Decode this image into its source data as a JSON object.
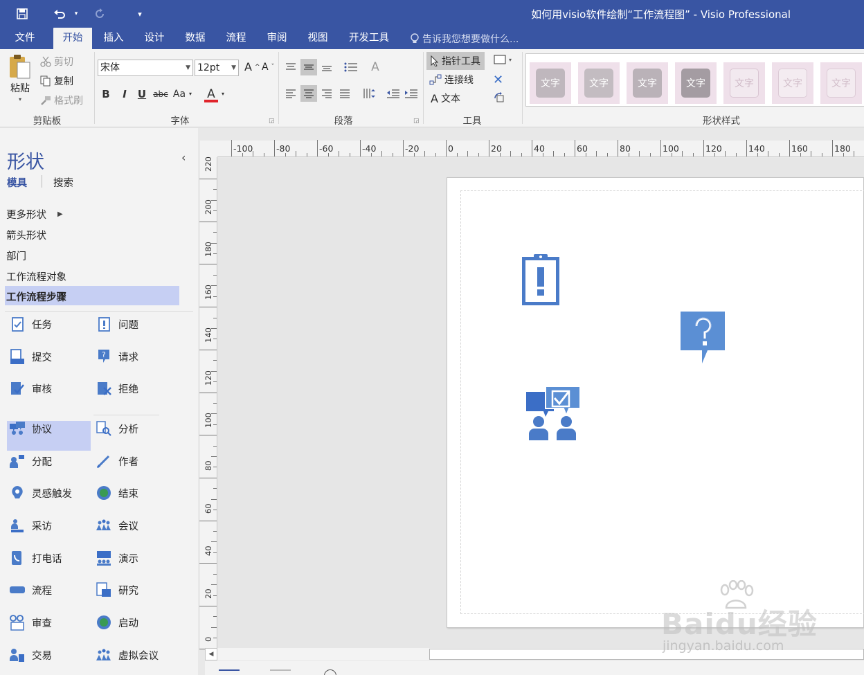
{
  "window": {
    "title": "如何用visio软件绘制“工作流程图” - Visio Professional"
  },
  "quick_access": {
    "save": "save-icon",
    "undo": "undo-icon",
    "redo": "redo-icon",
    "customize": "▾"
  },
  "menu": {
    "tabs": [
      "文件",
      "开始",
      "插入",
      "设计",
      "数据",
      "流程",
      "审阅",
      "视图",
      "开发工具"
    ],
    "active": "开始",
    "tell_me": "告诉我您想要做什么..."
  },
  "ribbon": {
    "clipboard": {
      "paste": "粘贴",
      "cut": "剪切",
      "copy": "复制",
      "format_painter": "格式刷",
      "label": "剪贴板"
    },
    "font": {
      "family": "宋体",
      "size": "12pt",
      "bold": "B",
      "italic": "I",
      "underline": "U",
      "strike": "abc",
      "case": "Aa",
      "grow": "A",
      "shrink": "A",
      "color_letter": "A",
      "label": "字体",
      "color": "#e0242b"
    },
    "paragraph": {
      "label": "段落"
    },
    "tools": {
      "pointer": "指针工具",
      "connector": "连接线",
      "text": "文本",
      "text_glyph": "A",
      "label": "工具"
    },
    "shape_styles": {
      "label": "形状样式",
      "swatch_text": "文字",
      "swatch_colors": [
        "#bfb7bd",
        "#c3bcc1",
        "#bab2b8",
        "#a49ca2",
        "#f2e9ef",
        "#f4ecf1",
        "#f3ebf0"
      ]
    }
  },
  "shapes_panel": {
    "title": "形状",
    "tabs": [
      "模具",
      "搜索"
    ],
    "stencils": [
      "更多形状",
      "箭头形状",
      "部门",
      "工作流程对象",
      "工作流程步骤"
    ],
    "selected_stencil": "工作流程步骤",
    "items": [
      [
        "任务",
        "问题"
      ],
      [
        "提交",
        "请求"
      ],
      [
        "审核",
        "拒绝"
      ],
      [
        "协议",
        "分析"
      ],
      [
        "分配",
        "作者"
      ],
      [
        "灵感触发",
        "结束"
      ],
      [
        "采访",
        "会议"
      ],
      [
        "打电话",
        "演示"
      ],
      [
        "流程",
        "研究"
      ],
      [
        "审查",
        "启动"
      ],
      [
        "交易",
        "虚拟会议"
      ]
    ],
    "selected_item": "协议"
  },
  "ruler": {
    "h_labels": [
      "-100",
      "-80",
      "-60",
      "-40",
      "-20",
      "0",
      "20",
      "40",
      "60",
      "80",
      "100",
      "120",
      "140",
      "160",
      "180"
    ],
    "v_labels": [
      "220",
      "200",
      "180",
      "160",
      "140",
      "120",
      "100",
      "80",
      "60",
      "40",
      "20",
      "0"
    ]
  },
  "colors": {
    "brand": "#3955a3",
    "icon_blue": "#4a7bc8",
    "selected": "#c6cff3"
  },
  "watermark": {
    "brand": "Baidu经验",
    "url": "jingyan.baidu.com"
  }
}
